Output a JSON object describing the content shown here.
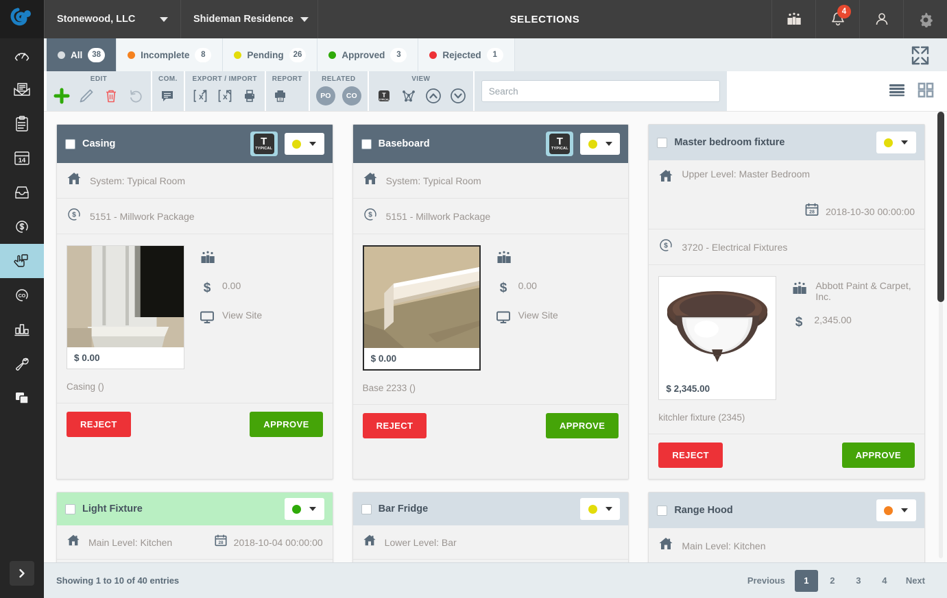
{
  "header": {
    "company": "Stonewood, LLC",
    "project": "Shideman Residence",
    "title": "SELECTIONS",
    "icons": [
      {
        "name": "vendors-icon",
        "label": "Vendors"
      },
      {
        "name": "notifications-bell-icon",
        "label": "Notifications",
        "badge": "4"
      },
      {
        "name": "user-profile-icon",
        "label": "Profile"
      },
      {
        "name": "settings-gear-icon",
        "label": "Settings"
      }
    ]
  },
  "sidebar": {
    "items": [
      {
        "name": "dashboard",
        "label": "Dashboard",
        "active": false
      },
      {
        "name": "mail",
        "label": "Mail",
        "active": false
      },
      {
        "name": "tasks",
        "label": "Tasks",
        "active": false
      },
      {
        "name": "calendar",
        "label": "Calendar",
        "active": false
      },
      {
        "name": "files",
        "label": "Files",
        "active": false
      },
      {
        "name": "budget",
        "label": "Budget",
        "active": false
      },
      {
        "name": "selections",
        "label": "Selections",
        "active": true
      },
      {
        "name": "change-orders",
        "label": "Change Orders",
        "active": false
      },
      {
        "name": "reports",
        "label": "Reports",
        "active": false
      },
      {
        "name": "tools",
        "label": "Tools",
        "active": false
      },
      {
        "name": "documents",
        "label": "Documents",
        "active": false
      }
    ],
    "expand_label": "Expand menu"
  },
  "tabs": [
    {
      "label": "All",
      "count": "38",
      "color": "#d8dde0",
      "active": true
    },
    {
      "label": "Incomplete",
      "count": "8",
      "color": "#f58220",
      "active": false
    },
    {
      "label": "Pending",
      "count": "26",
      "color": "#e3dc0a",
      "active": false
    },
    {
      "label": "Approved",
      "count": "3",
      "color": "#2faa09",
      "active": false
    },
    {
      "label": "Rejected",
      "count": "1",
      "color": "#ed3237",
      "active": false
    }
  ],
  "toolbar": {
    "groups": [
      {
        "label": "EDIT",
        "buttons": [
          {
            "name": "add-button",
            "glyph": "plus"
          },
          {
            "name": "edit-pencil-button",
            "glyph": "pencil"
          },
          {
            "name": "delete-trash-button",
            "glyph": "trash"
          },
          {
            "name": "undo-button",
            "glyph": "undo"
          }
        ]
      },
      {
        "label": "COM.",
        "buttons": [
          {
            "name": "comment-button",
            "glyph": "comment"
          }
        ]
      },
      {
        "label": "EXPORT / IMPORT",
        "buttons": [
          {
            "name": "export-excel-button",
            "glyph": "export"
          },
          {
            "name": "import-excel-button",
            "glyph": "import"
          },
          {
            "name": "print-label-button",
            "glyph": "printer-label"
          }
        ]
      },
      {
        "label": "REPORT",
        "buttons": [
          {
            "name": "print-report-button",
            "glyph": "print"
          }
        ]
      },
      {
        "label": "RELATED",
        "buttons": [
          {
            "name": "purchase-order-button",
            "glyph": "PO"
          },
          {
            "name": "change-order-button",
            "glyph": "CO"
          }
        ]
      },
      {
        "label": "VIEW",
        "buttons": [
          {
            "name": "typical-view-button",
            "glyph": "typical"
          },
          {
            "name": "hierarchy-view-button",
            "glyph": "hierarchy"
          },
          {
            "name": "collapse-all-button",
            "glyph": "chevron-up"
          },
          {
            "name": "expand-all-button",
            "glyph": "chevron-down"
          }
        ]
      }
    ],
    "search_placeholder": "Search",
    "search_value": "",
    "view_list_label": "List view",
    "view_grid_label": "Grid view"
  },
  "cards": [
    {
      "title": "Casing",
      "header_style": "slate",
      "typical": true,
      "typical_badge_letter": "T",
      "typical_badge_word": "TYPICAL",
      "status_color": "#e3dc0a",
      "location": "System: Typical Room",
      "date": "",
      "cost_code": "5151 - Millwork Package",
      "thumb_price": "$ 0.00",
      "vendor": "",
      "price": "0.00",
      "view_site": "View Site",
      "description": "Casing ()",
      "reject_label": "REJECT",
      "approve_label": "APPROVE",
      "image": "casing"
    },
    {
      "title": "Baseboard",
      "header_style": "slate",
      "typical": true,
      "typical_badge_letter": "T",
      "typical_badge_word": "TYPICAL",
      "status_color": "#e3dc0a",
      "location": "System: Typical Room",
      "date": "",
      "cost_code": "5151 - Millwork Package",
      "thumb_price": "$ 0.00",
      "vendor": "",
      "price": "0.00",
      "view_site": "View Site",
      "description": "Base 2233 ()",
      "reject_label": "REJECT",
      "approve_label": "APPROVE",
      "image": "baseboard"
    },
    {
      "title": "Master bedroom fixture",
      "header_style": "pale",
      "typical": false,
      "status_color": "#e3dc0a",
      "location": "Upper Level: Master Bedroom",
      "date": "2018-10-30 00:00:00",
      "cost_code": "3720 - Electrical Fixtures",
      "thumb_price": "$ 2,345.00",
      "vendor": "Abbott Paint & Carpet, Inc.",
      "price": "2,345.00",
      "view_site": "",
      "description": "kitchler fixture (2345)",
      "reject_label": "REJECT",
      "approve_label": "APPROVE",
      "image": "fixture"
    }
  ],
  "cards_partial": [
    {
      "title": "Light Fixture",
      "header_style": "green",
      "status_color": "#2faa09",
      "location": "Main Level: Kitchen",
      "date": "2018-10-04 00:00:00"
    },
    {
      "title": "Bar Fridge",
      "header_style": "pale",
      "status_color": "#e3dc0a",
      "location": "Lower Level: Bar",
      "date": ""
    },
    {
      "title": "Range Hood",
      "header_style": "pale",
      "status_color": "#f58220",
      "location": "Main Level: Kitchen",
      "date": ""
    }
  ],
  "footer": {
    "info": "Showing 1 to 10 of 40 entries",
    "previous": "Previous",
    "next": "Next",
    "pages": [
      "1",
      "2",
      "3",
      "4"
    ],
    "active_page": "1"
  }
}
